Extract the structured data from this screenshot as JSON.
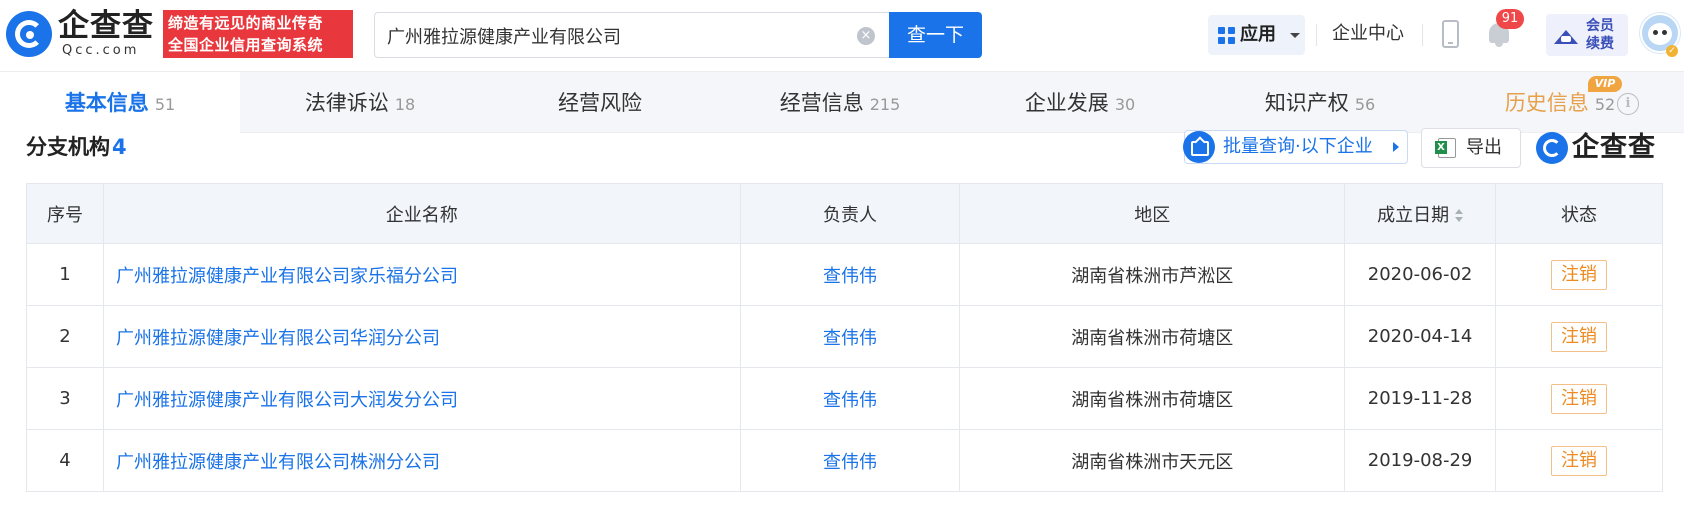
{
  "header": {
    "logo_name": "企查查",
    "logo_sub": "Qcc.com",
    "slogan_line1": "缔造有远见的商业传奇",
    "slogan_line2": "全国企业信用查询系统",
    "search_value": "广州雅拉源健康产业有限公司",
    "search_button": "查一下",
    "app_label": "应用",
    "enterprise_center": "企业中心",
    "notification_count": "91",
    "vip_line1": "会员",
    "vip_line2": "续费"
  },
  "tabs": [
    {
      "label": "基本信息",
      "count": "51"
    },
    {
      "label": "法律诉讼",
      "count": "18"
    },
    {
      "label": "经营风险",
      "count": ""
    },
    {
      "label": "经营信息",
      "count": "215"
    },
    {
      "label": "企业发展",
      "count": "30"
    },
    {
      "label": "知识产权",
      "count": "56"
    },
    {
      "label": "历史信息",
      "count": "52"
    }
  ],
  "vip_tag": "VIP",
  "section": {
    "title": "分支机构",
    "count": "4",
    "batch_button": "批量查询·以下企业",
    "export_button": "导出",
    "logo_text": "企查查"
  },
  "table": {
    "headers": [
      "序号",
      "企业名称",
      "负责人",
      "地区",
      "成立日期",
      "状态"
    ],
    "rows": [
      {
        "no": "1",
        "name": "广州雅拉源健康产业有限公司家乐福分公司",
        "person": "查伟伟",
        "region": "湖南省株洲市芦淞区",
        "date": "2020-06-02",
        "status": "注销"
      },
      {
        "no": "2",
        "name": "广州雅拉源健康产业有限公司华润分公司",
        "person": "查伟伟",
        "region": "湖南省株洲市荷塘区",
        "date": "2020-04-14",
        "status": "注销"
      },
      {
        "no": "3",
        "name": "广州雅拉源健康产业有限公司大润发分公司",
        "person": "查伟伟",
        "region": "湖南省株洲市荷塘区",
        "date": "2019-11-28",
        "status": "注销"
      },
      {
        "no": "4",
        "name": "广州雅拉源健康产业有限公司株洲分公司",
        "person": "查伟伟",
        "region": "湖南省株洲市天元区",
        "date": "2019-08-29",
        "status": "注销"
      }
    ]
  }
}
